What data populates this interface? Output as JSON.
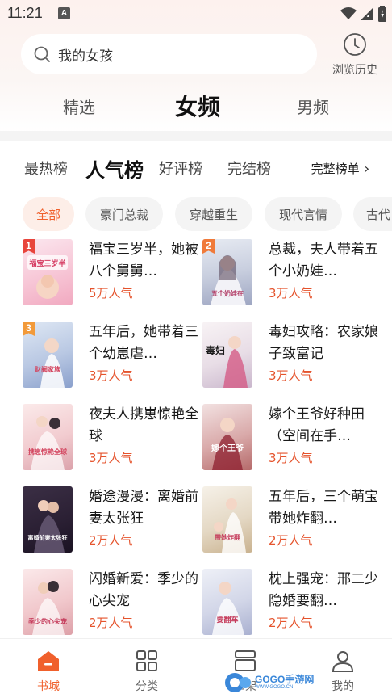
{
  "status_bar": {
    "time": "11:21",
    "notification_icon": "A"
  },
  "search": {
    "query": "我的女孩"
  },
  "history": {
    "label": "浏览历史"
  },
  "channel_tabs": [
    {
      "label": "精选",
      "active": false
    },
    {
      "label": "女频",
      "active": true
    },
    {
      "label": "男频",
      "active": false
    }
  ],
  "rank_tabs": [
    {
      "label": "最热榜",
      "active": false
    },
    {
      "label": "人气榜",
      "active": true
    },
    {
      "label": "好评榜",
      "active": false
    },
    {
      "label": "完结榜",
      "active": false
    }
  ],
  "full_rank": {
    "label": "完整榜单"
  },
  "categories": [
    {
      "label": "全部",
      "active": true
    },
    {
      "label": "豪门总裁",
      "active": false
    },
    {
      "label": "穿越重生",
      "active": false
    },
    {
      "label": "现代言情",
      "active": false
    },
    {
      "label": "古代",
      "active": false
    }
  ],
  "books": [
    {
      "rank": "1",
      "title": "福宝三岁半，她被八个舅舅…",
      "popularity": "5万人气",
      "cover_text": "福宝三岁半"
    },
    {
      "rank": "2",
      "title": "总裁，夫人带着五个小奶娃…",
      "popularity": "3万人气",
      "cover_text": "五个奶娃在"
    },
    {
      "rank": "3",
      "title": "五年后，她带着三个幼崽虐…",
      "popularity": "3万人气",
      "cover_text": "财阀家族"
    },
    {
      "rank": "",
      "title": "毒妇攻略：农家娘子致富记",
      "popularity": "3万人气",
      "cover_text": "毒妇"
    },
    {
      "rank": "",
      "title": "夜夫人携崽惊艳全球",
      "popularity": "3万人气",
      "cover_text": "携崽惊艳全球"
    },
    {
      "rank": "",
      "title": "嫁个王爷好种田（空间在手…",
      "popularity": "3万人气",
      "cover_text": "嫁个王爷"
    },
    {
      "rank": "",
      "title": "婚途漫漫：离婚前妻太张狂",
      "popularity": "2万人气",
      "cover_text": "离婚前妻太张狂"
    },
    {
      "rank": "",
      "title": "五年后，三个萌宝带她炸翻…",
      "popularity": "2万人气",
      "cover_text": "带她炸翻"
    },
    {
      "rank": "",
      "title": "闪婚新爱：季少的心尖宠",
      "popularity": "2万人气",
      "cover_text": "季少的心尖宠"
    },
    {
      "rank": "",
      "title": "枕上强宠：邢二少隐婚要翻…",
      "popularity": "2万人气",
      "cover_text": "要翻车"
    }
  ],
  "bottom_nav": [
    {
      "label": "书城",
      "active": true
    },
    {
      "label": "分类",
      "active": false
    },
    {
      "label": "书架",
      "active": false
    },
    {
      "label": "我的",
      "active": false
    }
  ],
  "watermark": {
    "brand": "GOGO手游网",
    "url": "WWW.GOGO.CN"
  },
  "colors": {
    "accent": "#f0602c",
    "popularity": "#e5532c",
    "rank1": "#e8453c",
    "rank2": "#f07a3a",
    "rank3": "#f29a3a"
  }
}
